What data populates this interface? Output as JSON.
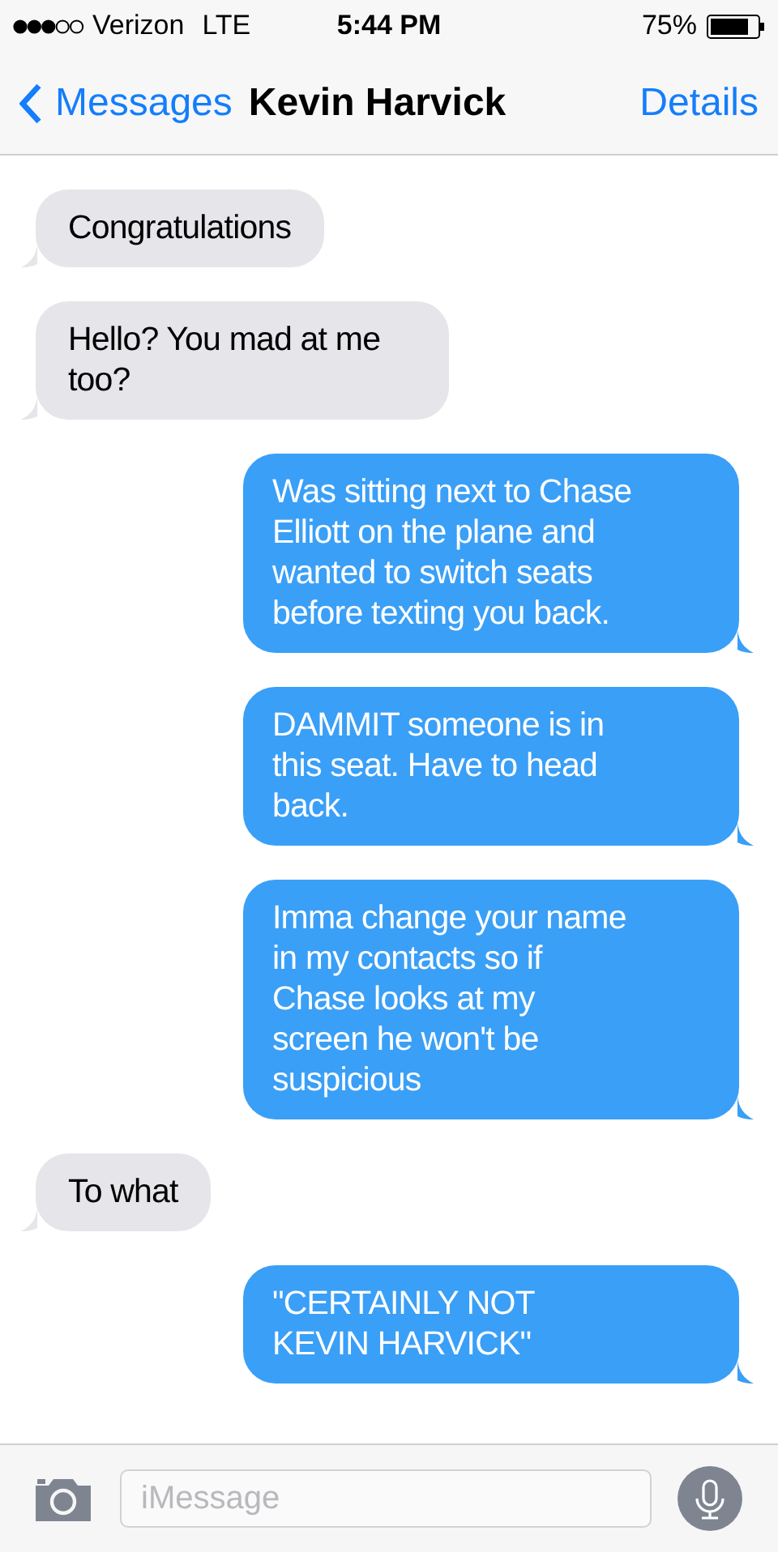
{
  "status_bar": {
    "carrier": "Verizon",
    "network": "LTE",
    "time": "5:44 PM",
    "battery": "75%"
  },
  "nav": {
    "back": "Messages",
    "title": "Kevin Harvick",
    "action": "Details"
  },
  "messages": [
    {
      "kind": "received",
      "text": "Congratulations"
    },
    {
      "kind": "received",
      "text": "Hello? You mad at me too?"
    },
    {
      "kind": "sent",
      "text": "Was sitting next to Chase Elliott on the plane and wanted to switch seats before texting you back."
    },
    {
      "kind": "sent",
      "text": "DAMMIT someone is in this seat. Have to head back."
    },
    {
      "kind": "sent",
      "text": "Imma change your name in my contacts so if Chase looks at my screen he won't be suspicious"
    },
    {
      "kind": "received",
      "text": "To what"
    },
    {
      "kind": "sent",
      "text": "\"CERTAINLY NOT KEVIN HARVICK\""
    }
  ],
  "composer": {
    "placeholder": "iMessage"
  }
}
